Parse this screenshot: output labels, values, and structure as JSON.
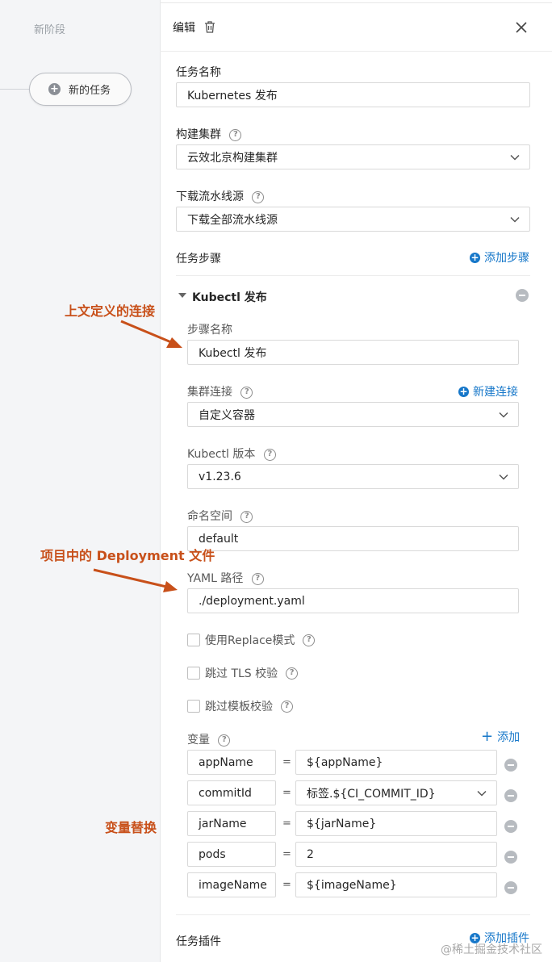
{
  "left": {
    "stage_label": "新阶段",
    "new_task_label": "新的任务"
  },
  "header": {
    "title": "编辑"
  },
  "form": {
    "task_name_label": "任务名称",
    "task_name_value": "Kubernetes 发布",
    "build_cluster_label": "构建集群",
    "build_cluster_value": "云效北京构建集群",
    "download_source_label": "下载流水线源",
    "download_source_value": "下载全部流水线源",
    "task_steps_label": "任务步骤",
    "add_step_label": "添加步骤",
    "step": {
      "title": "Kubectl 发布",
      "step_name_label": "步骤名称",
      "step_name_value": "Kubectl 发布",
      "cluster_conn_label": "集群连接",
      "new_conn_label": "新建连接",
      "cluster_conn_value": "自定义容器",
      "kubectl_version_label": "Kubectl 版本",
      "kubectl_version_value": "v1.23.6",
      "namespace_label": "命名空间",
      "namespace_value": "default",
      "yaml_path_label": "YAML 路径",
      "yaml_path_value": "./deployment.yaml",
      "replace_mode_label": "使用Replace模式",
      "skip_tls_label": "跳过 TLS 校验",
      "skip_template_label": "跳过模板校验",
      "variables_label": "变量",
      "add_label": "添加",
      "variables": [
        {
          "name": "appName",
          "value": "${appName}"
        },
        {
          "name": "commitId",
          "value": "标签.${CI_COMMIT_ID}"
        },
        {
          "name": "jarName",
          "value": "${jarName}"
        },
        {
          "name": "pods",
          "value": "2"
        },
        {
          "name": "imageName",
          "value": "${imageName}"
        }
      ],
      "equals": "="
    },
    "task_plugins_label": "任务插件",
    "add_plugin_label": "添加插件"
  },
  "annotations": {
    "context_conn": "上文定义的连接",
    "deployment_file": "项目中的 Deployment 文件",
    "var_replace": "变量替换"
  },
  "watermark": "@稀土掘金技术社区",
  "colors": {
    "accent_blue": "#1677c9",
    "annotation_orange": "#c8501a"
  }
}
